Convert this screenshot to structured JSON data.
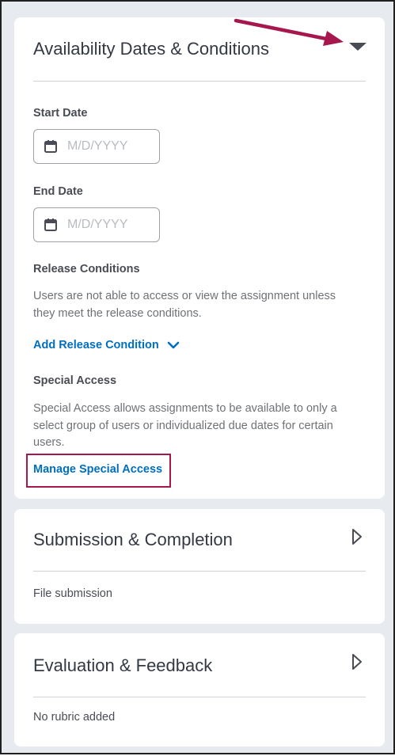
{
  "availability": {
    "title": "Availability Dates & Conditions",
    "start_date": {
      "label": "Start Date",
      "value": "",
      "placeholder": "M/D/YYYY"
    },
    "end_date": {
      "label": "End Date",
      "value": "",
      "placeholder": "M/D/YYYY"
    },
    "release_conditions": {
      "heading": "Release Conditions",
      "description": "Users are not able to access or view the assignment unless they meet the release conditions.",
      "add_link": "Add Release Condition"
    },
    "special_access": {
      "heading": "Special Access",
      "description": "Special Access allows assignments to be available to only a select group of users or individualized due dates for certain users.",
      "manage_link": "Manage Special Access"
    }
  },
  "submission": {
    "title": "Submission & Completion",
    "summary": "File submission"
  },
  "evaluation": {
    "title": "Evaluation & Feedback",
    "summary": "No rubric added"
  },
  "icons": {
    "collapse_toggle": "triangle-down-icon",
    "expand_toggle": "triangle-right-icon",
    "calendar": "calendar-icon",
    "chevron": "chevron-down-icon",
    "annotation_arrow": "arrow-icon"
  },
  "colors": {
    "link": "#006fbf",
    "annotation": "#a6174d",
    "card_bg": "#ffffff",
    "panel_bg": "#e7ebf0"
  }
}
